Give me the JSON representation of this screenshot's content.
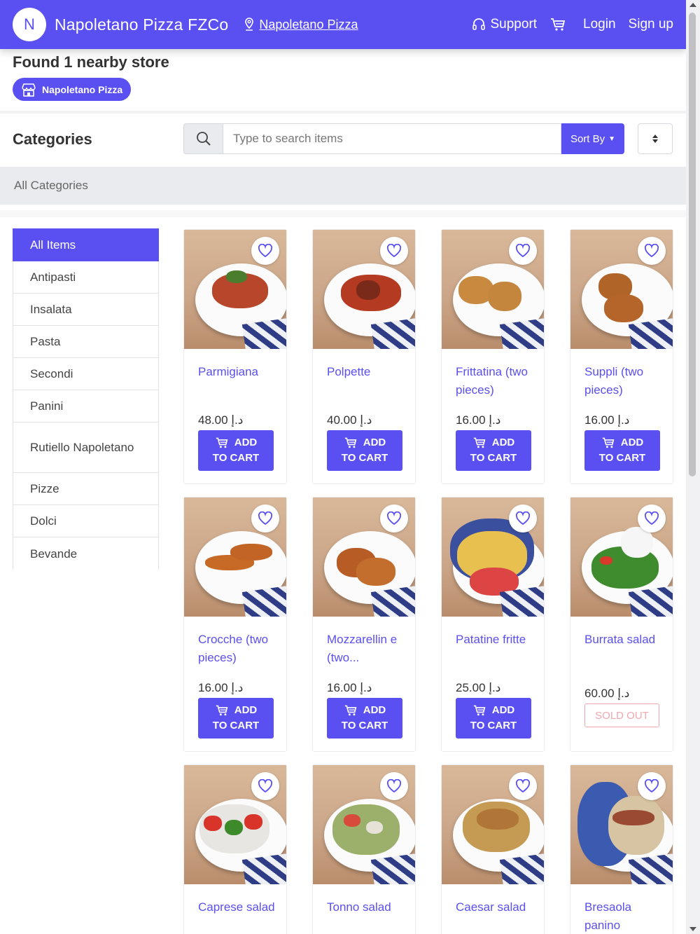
{
  "header": {
    "avatar_letter": "N",
    "brand": "Napoletano Pizza FZCo",
    "store_link": "Napoletano Pizza",
    "support": "Support",
    "login": "Login",
    "signup": "Sign up",
    "icons": {
      "store": "map-pin-icon",
      "support": "headset-icon",
      "cart": "cart-icon"
    }
  },
  "store_finder": {
    "found_text": "Found 1 nearby store",
    "store_pill": "Napoletano Pizza",
    "pill_icon": "storefront-icon"
  },
  "categories": {
    "title": "Categories",
    "search_placeholder": "Type to search items",
    "sort_label": "Sort By",
    "sort_direction_icon": "sort-arrows-icon",
    "breadcrumb": "All Categories",
    "items": [
      {
        "label": "All Items",
        "active": true
      },
      {
        "label": "Antipasti"
      },
      {
        "label": "Insalata"
      },
      {
        "label": "Pasta"
      },
      {
        "label": "Secondi"
      },
      {
        "label": "Panini"
      },
      {
        "label": "Rutiello Napoletano"
      },
      {
        "label": "Pizze"
      },
      {
        "label": "Dolci"
      },
      {
        "label": "Bevande"
      }
    ]
  },
  "products": {
    "add_line1": "ADD",
    "add_line2": "TO CART",
    "sold_out": "SOLD OUT",
    "items": [
      {
        "name": "Parmigiana",
        "price": "48.00 د.إ",
        "status": "available"
      },
      {
        "name": "Polpette",
        "price": "40.00 د.إ",
        "status": "available"
      },
      {
        "name": "Frittatina (two pieces)",
        "price": "16.00 د.إ",
        "status": "available"
      },
      {
        "name": "Suppli (two pieces)",
        "price": "16.00 د.إ",
        "status": "available"
      },
      {
        "name": "Crocche (two pieces)",
        "price": "16.00 د.إ",
        "status": "available"
      },
      {
        "name": "Mozzarellin e (two...",
        "price": "16.00 د.إ",
        "status": "available"
      },
      {
        "name": "Patatine fritte",
        "price": "25.00 د.إ",
        "status": "available"
      },
      {
        "name": "Burrata salad",
        "price": "60.00 د.إ",
        "status": "sold_out"
      },
      {
        "name": "Caprese salad",
        "price": "",
        "status": "unknown"
      },
      {
        "name": "Tonno salad",
        "price": "",
        "status": "unknown"
      },
      {
        "name": "Caesar salad",
        "price": "",
        "status": "unknown"
      },
      {
        "name": "Bresaola panino",
        "price": "",
        "status": "unknown"
      }
    ]
  },
  "colors": {
    "brand": "#5a4ff0",
    "sold_out": "#f0a7b0",
    "breadcrumb_bg": "#e9ebee"
  }
}
